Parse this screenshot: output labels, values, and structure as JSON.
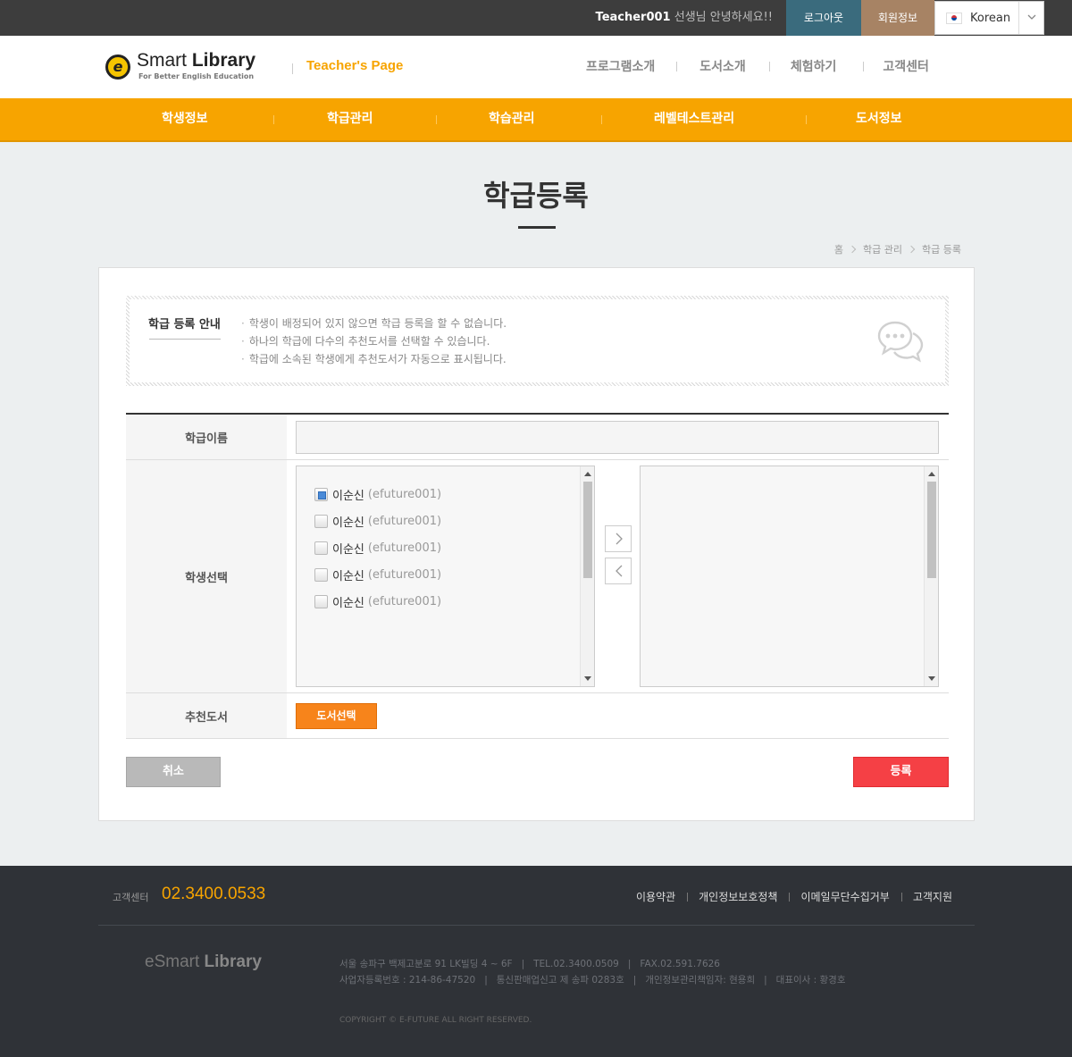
{
  "topbar": {
    "user_name": "Teacher001",
    "greeting_suffix": "선생님 안녕하세요!!",
    "logout_label": "로그아웃",
    "member_info_label": "회원정보",
    "language": "Korean"
  },
  "header": {
    "logo_main": "Smart",
    "logo_bold": "Library",
    "logo_tagline": "For Better English Education",
    "section_title": "Teacher's Page",
    "util_nav": [
      "프로그램소개",
      "도서소개",
      "체험하기",
      "고객센터"
    ]
  },
  "gnb": [
    "학생정보",
    "학급관리",
    "학습관리",
    "레벨테스트관리",
    "도서정보"
  ],
  "page": {
    "title": "학급등록",
    "breadcrumb": [
      "홈",
      "학급 관리",
      "학급 등록"
    ]
  },
  "notice": {
    "title": "학급 등록 안내",
    "items": [
      "학생이 배정되어 있지 않으면 학급 등록을 할 수 없습니다.",
      "하나의 학급에 다수의 추천도서를 선택할 수 있습니다.",
      "학급에 소속된 학생에게 추천도서가 자동으로 표시됩니다."
    ]
  },
  "form": {
    "class_name_label": "학급이름",
    "class_name_value": "",
    "student_select_label": "학생선택",
    "students": [
      {
        "name": "이순신",
        "id": "(efuture001)",
        "checked": true
      },
      {
        "name": "이순신",
        "id": "(efuture001)",
        "checked": false
      },
      {
        "name": "이순신",
        "id": "(efuture001)",
        "checked": false
      },
      {
        "name": "이순신",
        "id": "(efuture001)",
        "checked": false
      },
      {
        "name": "이순신",
        "id": "(efuture001)",
        "checked": false
      }
    ],
    "recommended_books_label": "추천도서",
    "select_books_button": "도서선택",
    "cancel_button": "취소",
    "register_button": "등록"
  },
  "footer": {
    "cs_label": "고객센터",
    "cs_phone": "02.3400.0533",
    "links": [
      "이용약관",
      "개인정보보호정책",
      "이메일무단수집거부",
      "고객지원"
    ],
    "logo_main": "eSmart",
    "logo_bold": "Library",
    "address": "서울 송파구 백제고분로 91 LK빌딩 4 ~ 6F",
    "tel": "TEL.02.3400.0509",
    "fax": "FAX.02.591.7626",
    "biz_no": "사업자등록번호 : 214-86-47520",
    "mail_order": "통신판매업신고 제 송파 0283호",
    "privacy_officer": "개인정보관리책임자: 현용희",
    "ceo": "대표이사 : 황경호",
    "copyright": "COPYRIGHT © E-FUTURE ALL RIGHT RESERVED."
  },
  "colors": {
    "accent_orange": "#f7a400",
    "button_orange": "#f7841b",
    "register_red": "#f54045",
    "logout_teal": "#3a6b7d",
    "member_brown": "#a78364"
  }
}
